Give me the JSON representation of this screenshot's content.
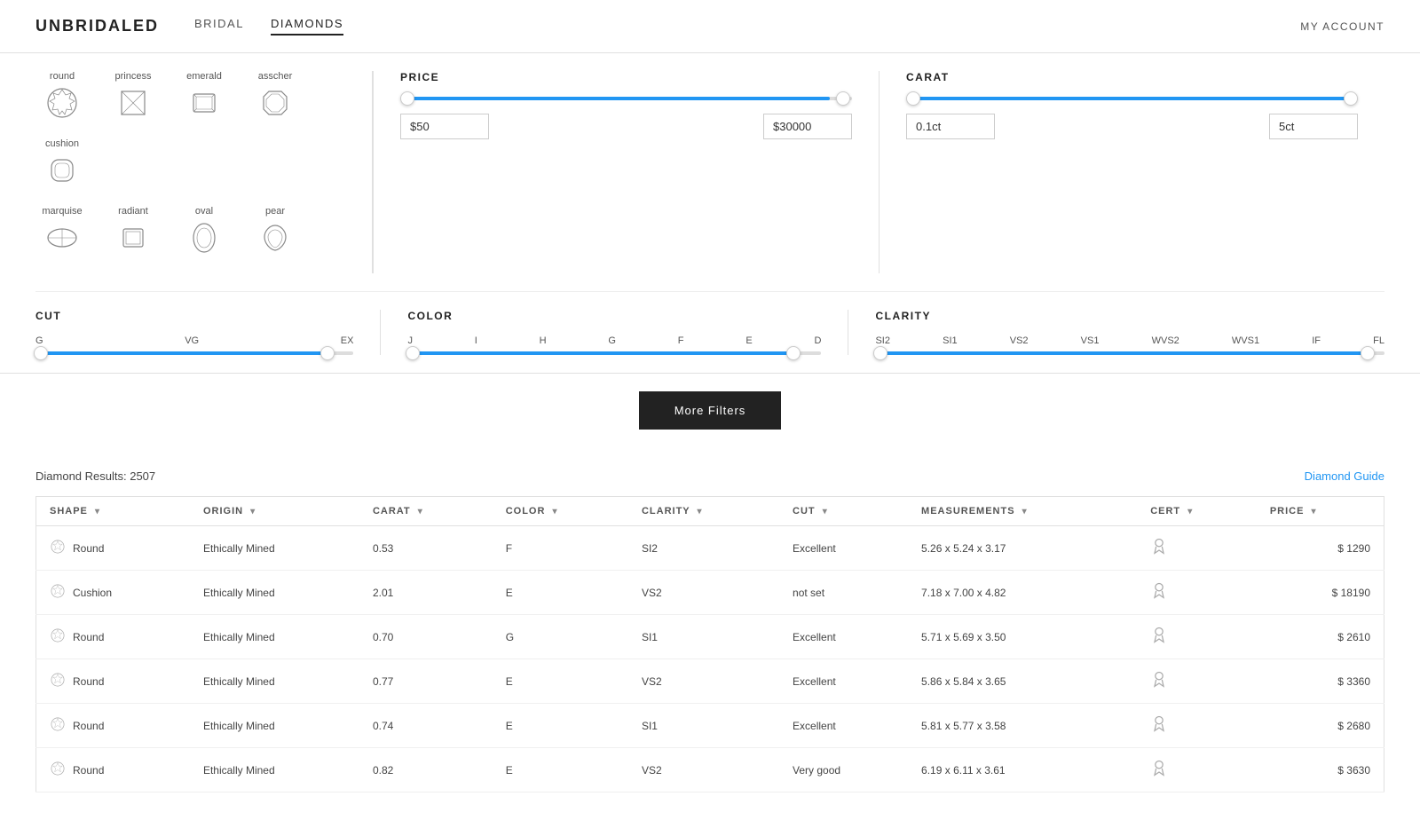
{
  "header": {
    "logo": "UNBRIDALED",
    "nav": [
      {
        "label": "BRIDAL",
        "active": false
      },
      {
        "label": "DIAMONDS",
        "active": true
      }
    ],
    "my_account": "MY ACCOUNT"
  },
  "shapes": [
    {
      "name": "round",
      "svg_type": "round"
    },
    {
      "name": "princess",
      "svg_type": "princess"
    },
    {
      "name": "emerald",
      "svg_type": "emerald"
    },
    {
      "name": "asscher",
      "svg_type": "asscher"
    },
    {
      "name": "cushion",
      "svg_type": "cushion"
    },
    {
      "name": "marquise",
      "svg_type": "marquise"
    },
    {
      "name": "radiant",
      "svg_type": "radiant"
    },
    {
      "name": "oval",
      "svg_type": "oval"
    },
    {
      "name": "pear",
      "svg_type": "pear"
    }
  ],
  "filters": {
    "price": {
      "title": "PRICE",
      "min": "$50",
      "max": "$30000",
      "fill_left_pct": 2,
      "fill_right_pct": 95
    },
    "carat": {
      "title": "CARAT",
      "min": "0.1ct",
      "max": "5ct",
      "fill_left_pct": 2,
      "fill_right_pct": 97
    },
    "cut": {
      "title": "CUT",
      "labels": [
        "G",
        "VG",
        "EX"
      ],
      "thumb_left_pct": 0,
      "fill_left_pct": 0,
      "fill_right_pct": 92,
      "thumb_right_pct": 92
    },
    "color": {
      "title": "COLOR",
      "labels": [
        "J",
        "I",
        "H",
        "G",
        "F",
        "E",
        "D"
      ],
      "thumb_left_pct": 0,
      "fill_left_pct": 0,
      "fill_right_pct": 92,
      "thumb_right_pct": 92
    },
    "clarity": {
      "title": "CLARITY",
      "labels": [
        "SI2",
        "SI1",
        "VS2",
        "VS1",
        "WVS2",
        "WVS1",
        "IF",
        "FL"
      ],
      "thumb_left_pct": 0,
      "fill_left_pct": 0,
      "fill_right_pct": 95,
      "thumb_right_pct": 95
    }
  },
  "more_filters_btn": "More Filters",
  "results": {
    "count_label": "Diamond Results: 2507",
    "guide_link": "Diamond Guide",
    "columns": [
      {
        "key": "shape",
        "label": "SHAPE"
      },
      {
        "key": "origin",
        "label": "ORIGIN"
      },
      {
        "key": "carat",
        "label": "CARAT"
      },
      {
        "key": "color",
        "label": "COLOR"
      },
      {
        "key": "clarity",
        "label": "CLARITY"
      },
      {
        "key": "cut",
        "label": "CUT"
      },
      {
        "key": "measurements",
        "label": "MEASUREMENTS"
      },
      {
        "key": "cert",
        "label": "CERT"
      },
      {
        "key": "price",
        "label": "PRICE"
      }
    ],
    "rows": [
      {
        "shape": "Round",
        "origin": "Ethically Mined",
        "carat": "0.53",
        "color": "F",
        "clarity": "SI2",
        "cut": "Excellent",
        "measurements": "5.26 x 5.24 x 3.17",
        "cert": "★",
        "price": "$ 1290"
      },
      {
        "shape": "Cushion",
        "origin": "Ethically Mined",
        "carat": "2.01",
        "color": "E",
        "clarity": "VS2",
        "cut": "not set",
        "measurements": "7.18 x 7.00 x 4.82",
        "cert": "★",
        "price": "$ 18190"
      },
      {
        "shape": "Round",
        "origin": "Ethically Mined",
        "carat": "0.70",
        "color": "G",
        "clarity": "SI1",
        "cut": "Excellent",
        "measurements": "5.71 x 5.69 x 3.50",
        "cert": "★",
        "price": "$ 2610"
      },
      {
        "shape": "Round",
        "origin": "Ethically Mined",
        "carat": "0.77",
        "color": "E",
        "clarity": "VS2",
        "cut": "Excellent",
        "measurements": "5.86 x 5.84 x 3.65",
        "cert": "★",
        "price": "$ 3360"
      },
      {
        "shape": "Round",
        "origin": "Ethically Mined",
        "carat": "0.74",
        "color": "E",
        "clarity": "SI1",
        "cut": "Excellent",
        "measurements": "5.81 x 5.77 x 3.58",
        "cert": "★",
        "price": "$ 2680"
      },
      {
        "shape": "Round",
        "origin": "Ethically Mined",
        "carat": "0.82",
        "color": "E",
        "clarity": "VS2",
        "cut": "Very good",
        "measurements": "6.19 x 6.11 x 3.61",
        "cert": "★",
        "price": "$ 3630"
      }
    ]
  }
}
